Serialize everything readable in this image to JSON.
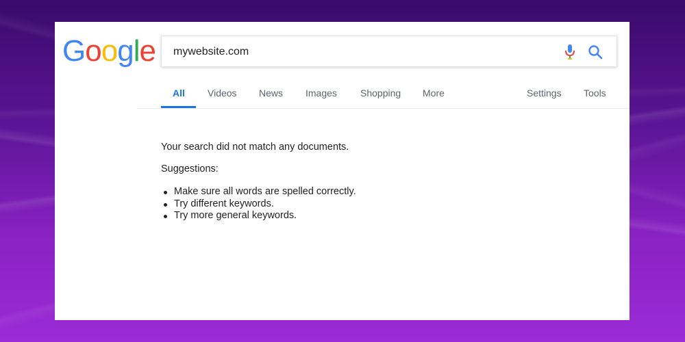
{
  "logo": {
    "letters": [
      "G",
      "o",
      "o",
      "g",
      "l",
      "e"
    ],
    "colors": [
      "#4285F4",
      "#EA4335",
      "#FBBC05",
      "#4285F4",
      "#34A853",
      "#EA4335"
    ]
  },
  "search": {
    "query": "mywebsite.com",
    "mic_icon": "mic-icon",
    "search_icon": "search-icon"
  },
  "tabs": [
    {
      "label": "All",
      "active": true
    },
    {
      "label": "Videos"
    },
    {
      "label": "News"
    },
    {
      "label": "Images"
    },
    {
      "label": "Shopping"
    },
    {
      "label": "More"
    },
    {
      "label": "Settings"
    },
    {
      "label": "Tools"
    }
  ],
  "results": {
    "message": "Your search did not match any documents.",
    "suggestions_heading": "Suggestions:",
    "suggestions": [
      "Make sure all words are spelled correctly.",
      "Try different keywords.",
      "Try more general keywords."
    ]
  },
  "colors": {
    "accent": "#1a73e8",
    "background_top": "#3a0a6b",
    "background_bottom": "#9b2bd6"
  }
}
